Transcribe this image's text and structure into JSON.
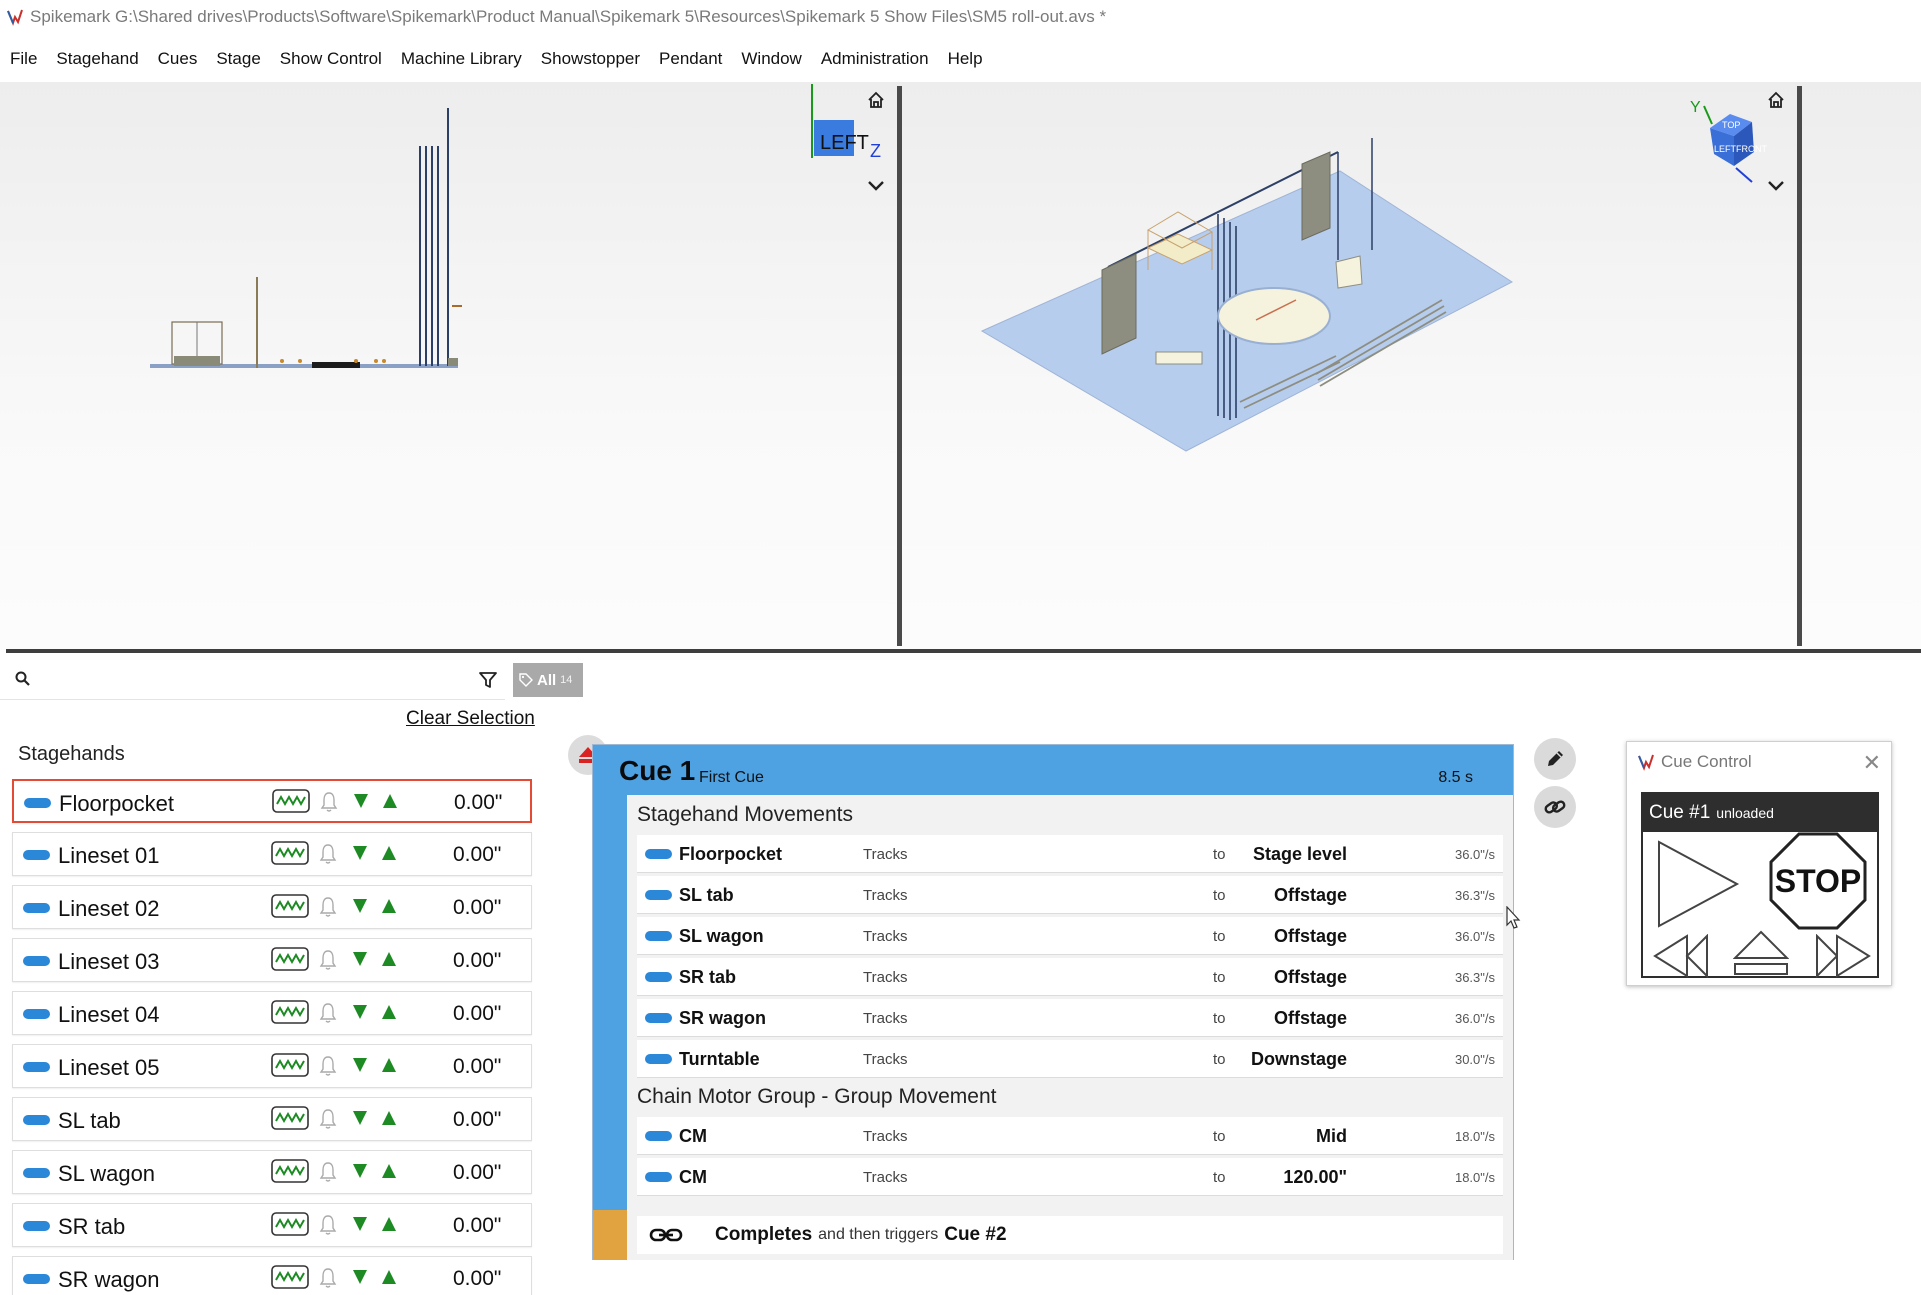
{
  "window": {
    "title": "Spikemark G:\\Shared drives\\Products\\Software\\Spikemark\\Product Manual\\Spikemark 5\\Resources\\Spikemark 5 Show Files\\SM5 roll-out.avs *"
  },
  "menu": [
    "File",
    "Stagehand",
    "Cues",
    "Stage",
    "Show Control",
    "Machine Library",
    "Showstopper",
    "Pendant",
    "Window",
    "Administration",
    "Help"
  ],
  "viewports": {
    "left": {
      "view_cube_label": "LEFT",
      "axis_label": "Z",
      "home_icon": "home-icon",
      "menu_icon": "chevron-down-icon"
    },
    "right": {
      "axis_label": "Y",
      "cube_faces": [
        "TOP",
        "LEFT",
        "FRONT"
      ],
      "home_icon": "home-icon",
      "menu_icon": "chevron-down-icon"
    }
  },
  "search": {
    "placeholder": "",
    "value": "",
    "filter_icon": "filter-icon"
  },
  "tag": {
    "label": "All",
    "count": "14"
  },
  "clear_selection": "Clear Selection",
  "stagehands": {
    "title": "Stagehands",
    "items": [
      {
        "name": "Floorpocket",
        "value": "0.00\"",
        "selected": true
      },
      {
        "name": "Lineset 01",
        "value": "0.00\""
      },
      {
        "name": "Lineset 02",
        "value": "0.00\""
      },
      {
        "name": "Lineset 03",
        "value": "0.00\""
      },
      {
        "name": "Lineset 04",
        "value": "0.00\""
      },
      {
        "name": "Lineset 05",
        "value": "0.00\""
      },
      {
        "name": "SL tab",
        "value": "0.00\""
      },
      {
        "name": "SL wagon",
        "value": "0.00\""
      },
      {
        "name": "SR tab",
        "value": "0.00\""
      },
      {
        "name": "SR wagon",
        "value": "0.00\""
      }
    ]
  },
  "cue": {
    "title": "Cue 1",
    "subtitle": "First Cue",
    "duration": "8.5 s",
    "groups": [
      {
        "title": "Stagehand Movements",
        "rows": [
          {
            "name": "Floorpocket",
            "action": "Tracks",
            "to": "to",
            "target": "Stage level",
            "speed": "36.0\"/s"
          },
          {
            "name": "SL tab",
            "action": "Tracks",
            "to": "to",
            "target": "Offstage",
            "speed": "36.3\"/s"
          },
          {
            "name": "SL wagon",
            "action": "Tracks",
            "to": "to",
            "target": "Offstage",
            "speed": "36.0\"/s"
          },
          {
            "name": "SR tab",
            "action": "Tracks",
            "to": "to",
            "target": "Offstage",
            "speed": "36.3\"/s"
          },
          {
            "name": "SR wagon",
            "action": "Tracks",
            "to": "to",
            "target": "Offstage",
            "speed": "36.0\"/s"
          },
          {
            "name": "Turntable",
            "action": "Tracks",
            "to": "to",
            "target": "Downstage",
            "speed": "30.0\"/s"
          }
        ]
      },
      {
        "title": "Chain Motor Group - Group Movement",
        "rows": [
          {
            "name": "CM",
            "action": "Tracks",
            "to": "to",
            "target": "Mid",
            "speed": "18.0\"/s"
          },
          {
            "name": "CM",
            "action": "Tracks",
            "to": "to",
            "target": "120.00\"",
            "speed": "18.0\"/s"
          }
        ]
      }
    ],
    "footer": {
      "completes": "Completes",
      "middle": "and then triggers",
      "next": "Cue #2"
    }
  },
  "cue_control": {
    "title": "Cue Control",
    "cue_label": "Cue #1",
    "cue_state": "unloaded",
    "stop_label": "STOP"
  },
  "colors": {
    "accent_blue": "#4ea2e2",
    "pill_blue": "#2b87d8",
    "arrow_green": "#1d8a24",
    "footer_orange": "#e1a340",
    "selected_red": "#e24b35"
  }
}
